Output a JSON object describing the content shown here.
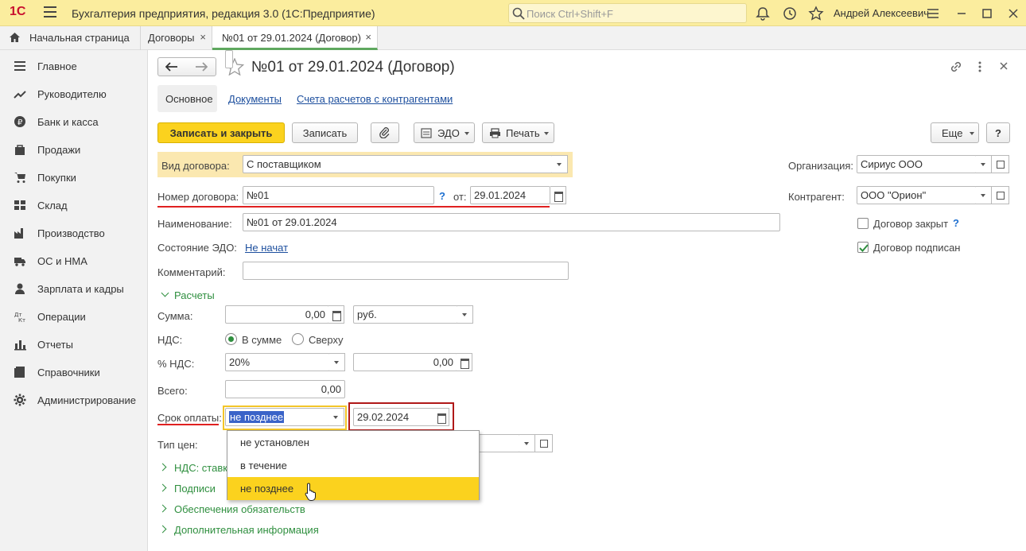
{
  "titlebar": {
    "logo": "1С",
    "app_title": "Бухгалтерия предприятия, редакция 3.0  (1С:Предприятие)",
    "search_placeholder": "Поиск Ctrl+Shift+F",
    "user": "Андрей Алексеевич"
  },
  "tabs": [
    {
      "label": "Начальная страница",
      "icon": "home-icon"
    },
    {
      "label": "Договоры",
      "close": "×"
    },
    {
      "label": "№01 от 29.01.2024 (Договор)",
      "close": "×",
      "active": true
    }
  ],
  "sidebar": {
    "items": [
      {
        "label": "Главное",
        "icon": "menu-lines-icon"
      },
      {
        "label": "Руководителю",
        "icon": "trend-icon"
      },
      {
        "label": "Банк и касса",
        "icon": "coin-icon"
      },
      {
        "label": "Продажи",
        "icon": "bag-icon"
      },
      {
        "label": "Покупки",
        "icon": "cart-icon"
      },
      {
        "label": "Склад",
        "icon": "warehouse-icon"
      },
      {
        "label": "Производство",
        "icon": "factory-icon"
      },
      {
        "label": "ОС и НМА",
        "icon": "truck-icon"
      },
      {
        "label": "Зарплата и кадры",
        "icon": "person-icon"
      },
      {
        "label": "Операции",
        "icon": "dt-kt-icon"
      },
      {
        "label": "Отчеты",
        "icon": "bar-chart-icon"
      },
      {
        "label": "Справочники",
        "icon": "book-icon"
      },
      {
        "label": "Администрирование",
        "icon": "gear-icon"
      }
    ]
  },
  "form": {
    "title": "№01 от 29.01.2024 (Договор)",
    "subtabs": {
      "main": "Основное",
      "docs": "Документы",
      "accounts": "Счета расчетов с контрагентами"
    },
    "toolbar": {
      "save_close": "Записать и закрыть",
      "save": "Записать",
      "edo": "ЭДО",
      "print": "Печать",
      "more": "Еще",
      "help": "?"
    },
    "contract_type_label": "Вид договора:",
    "contract_type_value": "С поставщиком",
    "number_label": "Номер договора:",
    "number_value": "№01",
    "number_help": "?",
    "date_label": "от:",
    "date_value": "29.01.2024",
    "name_label": "Наименование:",
    "name_value": "№01 от 29.01.2024",
    "edo_state_label": "Состояние ЭДО:",
    "edo_state_value": "Не начат",
    "comment_label": "Комментарий:",
    "comment_value": "",
    "org_label": "Организация:",
    "org_value": "Сириус ООО",
    "counterparty_label": "Контрагент:",
    "counterparty_value": "ООО \"Орион\"",
    "closed_label": "Договор закрыт",
    "closed_help": "?",
    "signed_label": "Договор подписан",
    "settlements_section": "Расчеты",
    "sum_label": "Сумма:",
    "sum_value": "0,00",
    "currency_value": "руб.",
    "vat_label": "НДС:",
    "vat_in_sum": "В сумме",
    "vat_on_top": "Сверху",
    "vat_rate_label": "% НДС:",
    "vat_rate_value": "20%",
    "vat_amount_value": "0,00",
    "total_label": "Всего:",
    "total_value": "0,00",
    "payment_term_label": "Срок оплаты:",
    "payment_term_value": "не позднее",
    "payment_date_value": "29.02.2024",
    "price_type_label": "Тип цен:",
    "vat_rates_section": "НДС: ставки",
    "signatures_section": "Подписи",
    "guarantees_section": "Обеспечения обязательств",
    "additional_section": "Дополнительная информация"
  },
  "dropdown": {
    "options": [
      "не установлен",
      "в течение",
      "не позднее"
    ],
    "selected": "не позднее"
  },
  "colors": {
    "accent": "#fbd21e",
    "titlebar": "#fbed9e",
    "link": "#1d4f9e",
    "green": "#2f8f3f",
    "error": "#e02020"
  }
}
